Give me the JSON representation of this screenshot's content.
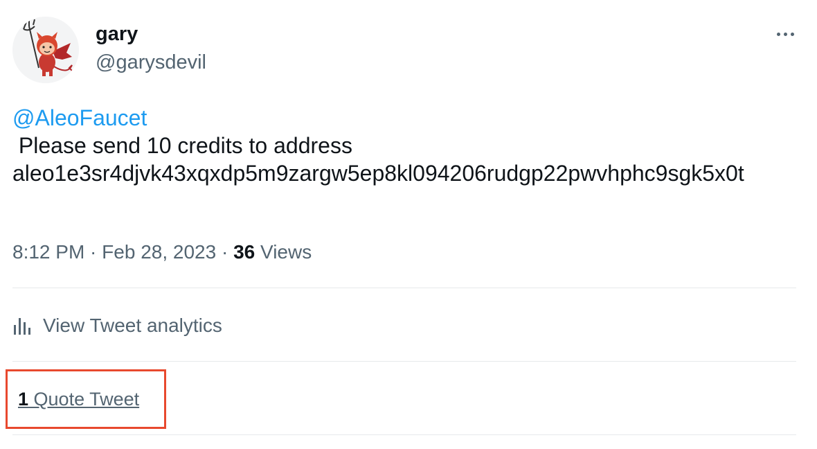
{
  "author": {
    "name": "gary",
    "handle": "@garysdevil",
    "avatar_icon": "devil-avatar-icon"
  },
  "more_icon": "more-options-icon",
  "tweet": {
    "mention": "@AleoFaucet",
    "message": " Please send 10 credits to address",
    "address": "aleo1e3sr4djvk43xqxdp5m9zargw5ep8kl094206rudgp22pwvhphc9sgk5x0t"
  },
  "meta": {
    "time": "8:12 PM",
    "separator": " · ",
    "date": "Feb 28, 2023",
    "views_count": "36",
    "views_label": " Views"
  },
  "analytics": {
    "icon": "analytics-bar-icon",
    "label": "View Tweet analytics"
  },
  "quotes": {
    "count": "1",
    "label": " Quote Tweet"
  },
  "colors": {
    "accent": "#1d9bf0",
    "secondary_text": "#536471",
    "highlight_box": "#e8492e"
  }
}
